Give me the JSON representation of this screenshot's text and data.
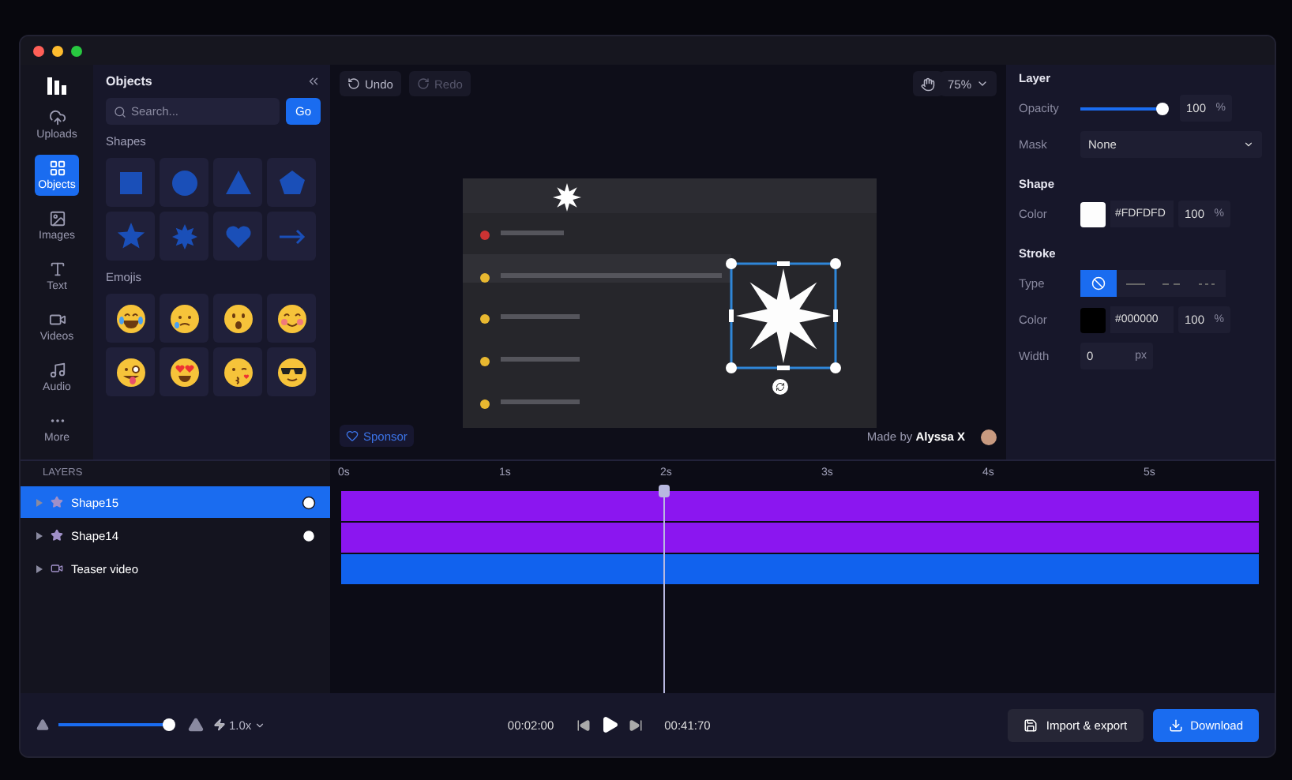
{
  "sidebar": {
    "items": [
      {
        "label": "Uploads",
        "kind": "uploads",
        "selected": false
      },
      {
        "label": "Objects",
        "kind": "objects",
        "selected": true
      },
      {
        "label": "Images",
        "kind": "images",
        "selected": false
      },
      {
        "label": "Text",
        "kind": "text",
        "selected": false
      },
      {
        "label": "Videos",
        "kind": "videos",
        "selected": false
      },
      {
        "label": "Audio",
        "kind": "audio",
        "selected": false
      },
      {
        "label": "More",
        "kind": "more",
        "selected": false
      }
    ]
  },
  "objects_panel": {
    "title": "Objects",
    "search": {
      "placeholder": "Search..."
    },
    "go_button": "Go",
    "sections": [
      {
        "title": "Shapes",
        "kind": "shapes",
        "items": [
          {
            "kind": "square"
          },
          {
            "kind": "circle"
          },
          {
            "kind": "triangle"
          },
          {
            "kind": "pentagon"
          },
          {
            "kind": "star"
          },
          {
            "kind": "burst"
          },
          {
            "kind": "heart"
          },
          {
            "kind": "arrow"
          }
        ]
      },
      {
        "title": "Emojis",
        "kind": "emojis",
        "items": [
          {
            "kind": "laugh"
          },
          {
            "kind": "tear"
          },
          {
            "kind": "surprised"
          },
          {
            "kind": "blush"
          },
          {
            "kind": "tongue"
          },
          {
            "kind": "hearteyes"
          },
          {
            "kind": "kiss"
          },
          {
            "kind": "sunglasses"
          }
        ]
      }
    ]
  },
  "canvas": {
    "toolbar": {
      "undo": {
        "label": "Undo",
        "disabled": false
      },
      "redo": {
        "label": "Redo",
        "disabled": true
      },
      "zoom": "75%"
    },
    "sponsor": "Sponsor",
    "credit": {
      "prefix": "Made by",
      "name": "Alyssa X"
    }
  },
  "properties": {
    "layer": {
      "title": "Layer",
      "opacity": {
        "label": "Opacity",
        "level": 1,
        "value": "100",
        "unit": "%"
      },
      "mask": {
        "label": "Mask",
        "value": "None"
      }
    },
    "shape": {
      "title": "Shape",
      "color": {
        "label": "Color",
        "hex": "#FDFDFD",
        "value": "100",
        "unit": "%"
      }
    },
    "stroke": {
      "title": "Stroke",
      "type": {
        "label": "Type",
        "options": [
          {
            "kind": "none",
            "selected": true
          },
          {
            "kind": "solid",
            "selected": false
          },
          {
            "kind": "dashed",
            "selected": false
          },
          {
            "kind": "dotted",
            "selected": false
          }
        ]
      },
      "color": {
        "label": "Color",
        "hex": "#000000",
        "value": "100",
        "unit": "%"
      },
      "width": {
        "label": "Width",
        "value": "0",
        "unit": "px"
      }
    }
  },
  "layers": {
    "title": "LAYERS",
    "items": [
      {
        "name": "Shape15",
        "kind": "shape",
        "selected": true,
        "animated": true
      },
      {
        "name": "Shape14",
        "kind": "shape",
        "selected": false,
        "animated": true
      },
      {
        "name": "Teaser video",
        "kind": "video",
        "selected": false,
        "animated": false
      }
    ]
  },
  "timeline": {
    "ticks": [
      "0s",
      "1s",
      "2s",
      "3s",
      "4s",
      "5s"
    ],
    "playhead": {
      "level": 0.352
    },
    "tracks": [
      {
        "color": "#8b16f0"
      },
      {
        "color": "#8b16f0"
      },
      {
        "color": "#1162ee"
      }
    ]
  },
  "playback": {
    "zoom": {
      "level": 1
    },
    "speed": "1.0x",
    "current_time": "00:02:00",
    "total_time": "00:41:70"
  },
  "actions": [
    {
      "label": "Import & export",
      "kind": "secondary"
    },
    {
      "label": "Download",
      "kind": "primary"
    }
  ]
}
